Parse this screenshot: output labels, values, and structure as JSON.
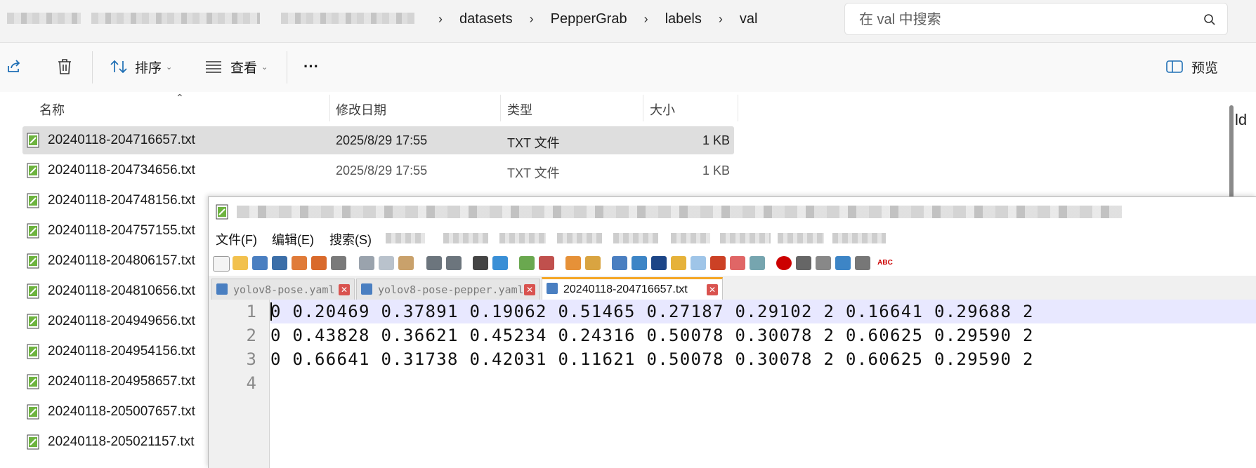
{
  "explorer": {
    "breadcrumbs": [
      "datasets",
      "PepperGrab",
      "labels",
      "val"
    ],
    "search": {
      "placeholder": "在 val 中搜索"
    },
    "toolbar": {
      "sort_label": "排序",
      "view_label": "查看",
      "more_label": "···",
      "preview_label": "预览"
    },
    "columns": {
      "name": "名称",
      "date": "修改日期",
      "type": "类型",
      "size": "大小"
    },
    "files": [
      {
        "name": "20240118-204716657.txt",
        "date": "2025/8/29 17:55",
        "type": "TXT 文件",
        "size": "1 KB"
      },
      {
        "name": "20240118-204734656.txt",
        "date": "2025/8/29 17:55",
        "type": "TXT 文件",
        "size": "1 KB"
      },
      {
        "name": "20240118-204748156.txt"
      },
      {
        "name": "20240118-204757155.txt"
      },
      {
        "name": "20240118-204806157.txt"
      },
      {
        "name": "20240118-204810656.txt"
      },
      {
        "name": "20240118-204949656.txt"
      },
      {
        "name": "20240118-204954156.txt"
      },
      {
        "name": "20240118-204958657.txt"
      },
      {
        "name": "20240118-205007657.txt"
      },
      {
        "name": "20240118-205021157.txt"
      }
    ],
    "edge_fragment": "ld"
  },
  "notepad": {
    "menu": {
      "file": "文件(F)",
      "edit": "编辑(E)",
      "search": "搜索(S)"
    },
    "tabs": [
      {
        "label": "yolov8-pose.yaml"
      },
      {
        "label": "yolov8-pose-pepper.yaml"
      },
      {
        "label": "20240118-204716657.txt"
      }
    ],
    "line_numbers": [
      "1",
      "2",
      "3",
      "4"
    ],
    "lines": [
      "0 0.20469 0.37891 0.19062 0.51465 0.27187 0.29102 2 0.16641 0.29688 2",
      "0 0.43828 0.36621 0.45234 0.24316 0.50078 0.30078 2 0.60625 0.29590 2",
      "0 0.66641 0.31738 0.42031 0.11621 0.50078 0.30078 2 0.60625 0.29590 2",
      ""
    ]
  }
}
